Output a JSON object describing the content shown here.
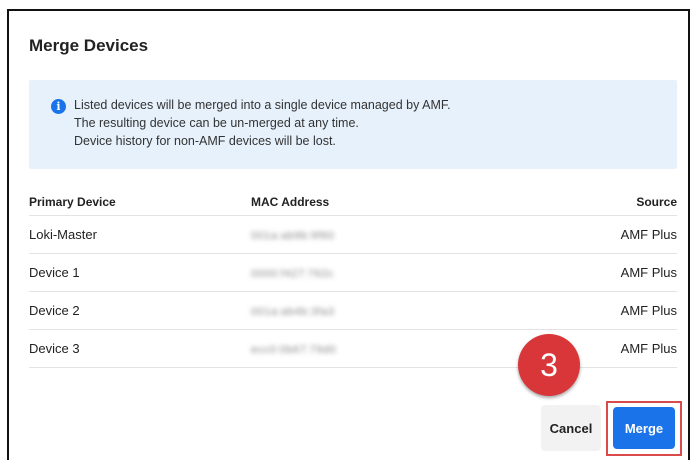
{
  "dialog": {
    "title": "Merge Devices",
    "info_lines": [
      "Listed devices will be merged into a single device managed by AMF.",
      "The resulting device can be un-merged at any time.",
      "Device history for non-AMF devices will be lost."
    ],
    "info_icon": "info-icon"
  },
  "table": {
    "headers": [
      "Primary Device",
      "MAC Address",
      "Source"
    ],
    "rows": [
      {
        "device": "Loki-Master",
        "mac": "001a:ab9b:9f60",
        "source": "AMF Plus"
      },
      {
        "device": "Device 1",
        "mac": "0000:f427:762c",
        "source": "AMF Plus"
      },
      {
        "device": "Device 2",
        "mac": "001a:ab4b:3fa3",
        "source": "AMF Plus"
      },
      {
        "device": "Device 3",
        "mac": "ecc0:0b67:79d0",
        "source": "AMF Plus"
      }
    ]
  },
  "annotation": {
    "step": "3"
  },
  "actions": {
    "cancel_label": "Cancel",
    "merge_label": "Merge"
  },
  "colors": {
    "accent": "#1a73e8",
    "banner_bg": "#e6f1fb",
    "highlight": "#d94a4a"
  }
}
